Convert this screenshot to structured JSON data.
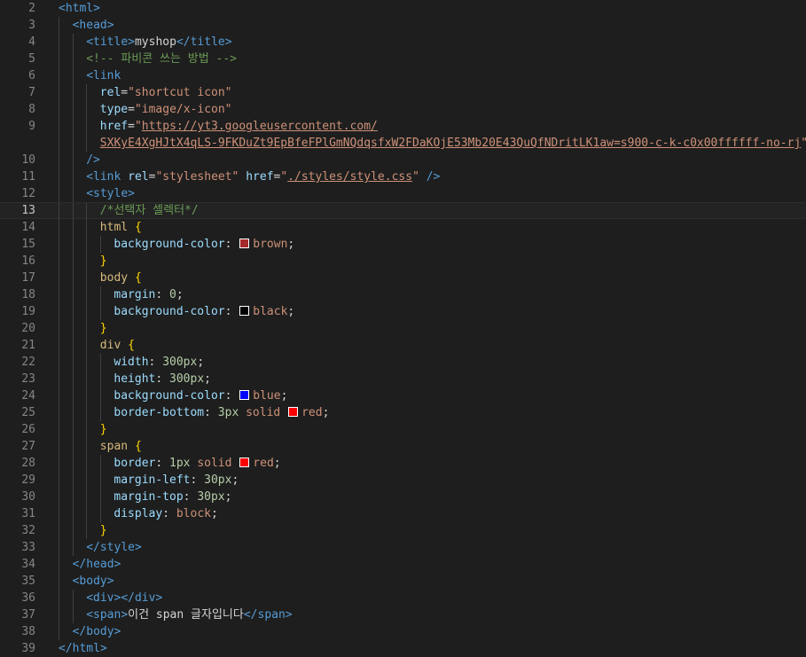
{
  "editor": {
    "active_line": 13,
    "lines": [
      {
        "n": "2",
        "indent": 0,
        "tokens": [
          [
            "tag",
            "<html>"
          ]
        ]
      },
      {
        "n": "3",
        "indent": 1,
        "tokens": [
          [
            "tag",
            "<head>"
          ]
        ]
      },
      {
        "n": "4",
        "indent": 2,
        "tokens": [
          [
            "tag",
            "<title>"
          ],
          [
            "txt",
            "myshop"
          ],
          [
            "tag",
            "</title>"
          ]
        ]
      },
      {
        "n": "5",
        "indent": 2,
        "tokens": [
          [
            "cmt",
            "<!-- 파비콘 쓰는 방법 -->"
          ]
        ]
      },
      {
        "n": "6",
        "indent": 2,
        "tokens": [
          [
            "tag",
            "<link"
          ]
        ]
      },
      {
        "n": "7",
        "indent": 3,
        "tokens": [
          [
            "attr",
            "rel"
          ],
          [
            "txt",
            "="
          ],
          [
            "str",
            "\"shortcut icon\""
          ]
        ]
      },
      {
        "n": "8",
        "indent": 3,
        "tokens": [
          [
            "attr",
            "type"
          ],
          [
            "txt",
            "="
          ],
          [
            "str",
            "\"image/x-icon\""
          ]
        ]
      },
      {
        "n": "9",
        "indent": 3,
        "tokens": [
          [
            "attr",
            "href"
          ],
          [
            "txt",
            "="
          ],
          [
            "str",
            "\""
          ],
          [
            "link",
            "https://yt3.googleusercontent.com/"
          ]
        ]
      },
      {
        "n": "",
        "indent": 3,
        "tokens": [
          [
            "link",
            "SXKyE4XgHJtX4qLS-9FKDuZt9EpBfeFPlGmNQdqsfxW2FDaKOjE53Mb20E43QuQfNDritLK1aw=s900-c-k-c0x00ffffff-no-rj"
          ],
          [
            "str",
            "\""
          ]
        ]
      },
      {
        "n": "10",
        "indent": 2,
        "tokens": [
          [
            "tag",
            "/>"
          ]
        ]
      },
      {
        "n": "11",
        "indent": 2,
        "tokens": [
          [
            "tag",
            "<link "
          ],
          [
            "attr",
            "rel"
          ],
          [
            "txt",
            "="
          ],
          [
            "str",
            "\"stylesheet\" "
          ],
          [
            "attr",
            "href"
          ],
          [
            "txt",
            "="
          ],
          [
            "str",
            "\""
          ],
          [
            "link",
            "./styles/style.css"
          ],
          [
            "str",
            "\" "
          ],
          [
            "tag",
            "/>"
          ]
        ]
      },
      {
        "n": "12",
        "indent": 2,
        "tokens": [
          [
            "tag",
            "<style>"
          ]
        ]
      },
      {
        "n": "13",
        "indent": 3,
        "tokens": [
          [
            "cmt",
            "/*선택자 셀렉터*/"
          ]
        ]
      },
      {
        "n": "14",
        "indent": 3,
        "tokens": [
          [
            "sel",
            "html "
          ],
          [
            "brace",
            "{"
          ]
        ]
      },
      {
        "n": "15",
        "indent": 4,
        "tokens": [
          [
            "prop",
            "background-color"
          ],
          [
            "txt",
            ": "
          ],
          [
            "swatch",
            "#a52a2a"
          ],
          [
            "val",
            "brown"
          ],
          [
            "txt",
            ";"
          ]
        ]
      },
      {
        "n": "16",
        "indent": 3,
        "tokens": [
          [
            "brace",
            "}"
          ]
        ]
      },
      {
        "n": "17",
        "indent": 3,
        "tokens": [
          [
            "sel",
            "body "
          ],
          [
            "brace",
            "{"
          ]
        ]
      },
      {
        "n": "18",
        "indent": 4,
        "tokens": [
          [
            "prop",
            "margin"
          ],
          [
            "txt",
            ": "
          ],
          [
            "num",
            "0"
          ],
          [
            "txt",
            ";"
          ]
        ]
      },
      {
        "n": "19",
        "indent": 4,
        "tokens": [
          [
            "prop",
            "background-color"
          ],
          [
            "txt",
            ": "
          ],
          [
            "swatch",
            "#000000"
          ],
          [
            "val",
            "black"
          ],
          [
            "txt",
            ";"
          ]
        ]
      },
      {
        "n": "20",
        "indent": 3,
        "tokens": [
          [
            "brace",
            "}"
          ]
        ]
      },
      {
        "n": "21",
        "indent": 3,
        "tokens": [
          [
            "sel",
            "div "
          ],
          [
            "brace",
            "{"
          ]
        ]
      },
      {
        "n": "22",
        "indent": 4,
        "tokens": [
          [
            "prop",
            "width"
          ],
          [
            "txt",
            ": "
          ],
          [
            "num",
            "300px"
          ],
          [
            "txt",
            ";"
          ]
        ]
      },
      {
        "n": "23",
        "indent": 4,
        "tokens": [
          [
            "prop",
            "height"
          ],
          [
            "txt",
            ": "
          ],
          [
            "num",
            "300px"
          ],
          [
            "txt",
            ";"
          ]
        ]
      },
      {
        "n": "24",
        "indent": 4,
        "tokens": [
          [
            "prop",
            "background-color"
          ],
          [
            "txt",
            ": "
          ],
          [
            "swatch",
            "#0000ff"
          ],
          [
            "val",
            "blue"
          ],
          [
            "txt",
            ";"
          ]
        ]
      },
      {
        "n": "25",
        "indent": 4,
        "tokens": [
          [
            "prop",
            "border-bottom"
          ],
          [
            "txt",
            ": "
          ],
          [
            "num",
            "3px"
          ],
          [
            "txt",
            " "
          ],
          [
            "val",
            "solid "
          ],
          [
            "swatch",
            "#ff0000"
          ],
          [
            "val",
            "red"
          ],
          [
            "txt",
            ";"
          ]
        ]
      },
      {
        "n": "26",
        "indent": 3,
        "tokens": [
          [
            "brace",
            "}"
          ]
        ]
      },
      {
        "n": "27",
        "indent": 3,
        "tokens": [
          [
            "sel",
            "span "
          ],
          [
            "brace",
            "{"
          ]
        ]
      },
      {
        "n": "28",
        "indent": 4,
        "tokens": [
          [
            "prop",
            "border"
          ],
          [
            "txt",
            ": "
          ],
          [
            "num",
            "1px"
          ],
          [
            "txt",
            " "
          ],
          [
            "val",
            "solid "
          ],
          [
            "swatch",
            "#ff0000"
          ],
          [
            "val",
            "red"
          ],
          [
            "txt",
            ";"
          ]
        ]
      },
      {
        "n": "29",
        "indent": 4,
        "tokens": [
          [
            "prop",
            "margin-left"
          ],
          [
            "txt",
            ": "
          ],
          [
            "num",
            "30px"
          ],
          [
            "txt",
            ";"
          ]
        ]
      },
      {
        "n": "30",
        "indent": 4,
        "tokens": [
          [
            "prop",
            "margin-top"
          ],
          [
            "txt",
            ": "
          ],
          [
            "num",
            "30px"
          ],
          [
            "txt",
            ";"
          ]
        ]
      },
      {
        "n": "31",
        "indent": 4,
        "tokens": [
          [
            "prop",
            "display"
          ],
          [
            "txt",
            ": "
          ],
          [
            "val",
            "block"
          ],
          [
            "txt",
            ";"
          ]
        ]
      },
      {
        "n": "32",
        "indent": 3,
        "tokens": [
          [
            "brace",
            "}"
          ]
        ]
      },
      {
        "n": "33",
        "indent": 2,
        "tokens": [
          [
            "tag",
            "</style>"
          ]
        ]
      },
      {
        "n": "34",
        "indent": 1,
        "tokens": [
          [
            "tag",
            "</head>"
          ]
        ]
      },
      {
        "n": "35",
        "indent": 1,
        "tokens": [
          [
            "tag",
            "<body>"
          ]
        ]
      },
      {
        "n": "36",
        "indent": 2,
        "tokens": [
          [
            "tag",
            "<div></div>"
          ]
        ]
      },
      {
        "n": "37",
        "indent": 2,
        "tokens": [
          [
            "tag",
            "<span>"
          ],
          [
            "txt",
            "이건 span 글자입니다"
          ],
          [
            "tag",
            "</span>"
          ]
        ]
      },
      {
        "n": "38",
        "indent": 1,
        "tokens": [
          [
            "tag",
            "</body>"
          ]
        ]
      },
      {
        "n": "39",
        "indent": 0,
        "tokens": [
          [
            "tag",
            "</html>"
          ]
        ]
      }
    ]
  },
  "colors": {
    "background": "#1e1e1e",
    "line_number": "#858585",
    "tag": "#569cd6",
    "attribute": "#9cdcfe",
    "string": "#ce9178",
    "comment": "#6a9955",
    "selector": "#d7ba7d",
    "number": "#b5cea8",
    "bracket": "#ffd700"
  }
}
